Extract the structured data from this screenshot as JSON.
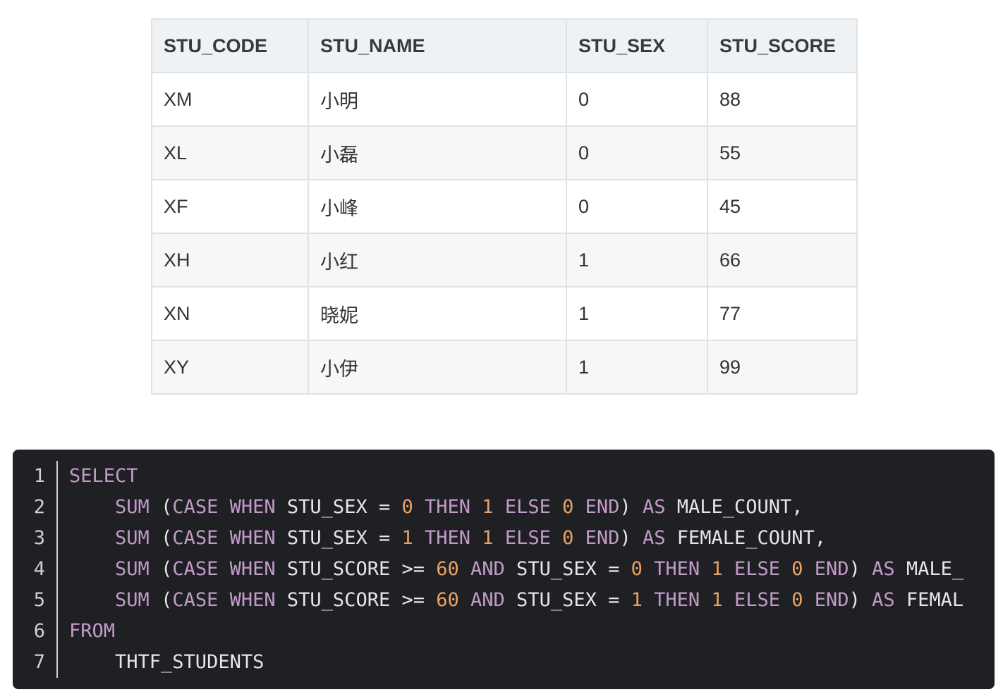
{
  "table": {
    "headers": [
      "STU_CODE",
      "STU_NAME",
      "STU_SEX",
      "STU_SCORE"
    ],
    "rows": [
      [
        "XM",
        "小明",
        "0",
        "88"
      ],
      [
        "XL",
        "小磊",
        "0",
        "55"
      ],
      [
        "XF",
        "小峰",
        "0",
        "45"
      ],
      [
        "XH",
        "小红",
        "1",
        "66"
      ],
      [
        "XN",
        "晓妮",
        "1",
        "77"
      ],
      [
        "XY",
        "小伊",
        "1",
        "99"
      ]
    ]
  },
  "code": {
    "line_numbers": [
      "1",
      "2",
      "3",
      "4",
      "5",
      "6",
      "7"
    ],
    "lines": [
      [
        {
          "t": "kw",
          "v": "SELECT"
        }
      ],
      [
        {
          "t": "id",
          "v": "    "
        },
        {
          "t": "kw",
          "v": "SUM"
        },
        {
          "t": "id",
          "v": " ("
        },
        {
          "t": "kw",
          "v": "CASE"
        },
        {
          "t": "id",
          "v": " "
        },
        {
          "t": "kw",
          "v": "WHEN"
        },
        {
          "t": "id",
          "v": " STU_SEX = "
        },
        {
          "t": "num",
          "v": "0"
        },
        {
          "t": "id",
          "v": " "
        },
        {
          "t": "kw",
          "v": "THEN"
        },
        {
          "t": "id",
          "v": " "
        },
        {
          "t": "num",
          "v": "1"
        },
        {
          "t": "id",
          "v": " "
        },
        {
          "t": "kw",
          "v": "ELSE"
        },
        {
          "t": "id",
          "v": " "
        },
        {
          "t": "num",
          "v": "0"
        },
        {
          "t": "id",
          "v": " "
        },
        {
          "t": "kw",
          "v": "END"
        },
        {
          "t": "id",
          "v": ") "
        },
        {
          "t": "kw",
          "v": "AS"
        },
        {
          "t": "id",
          "v": " MALE_COUNT,"
        }
      ],
      [
        {
          "t": "id",
          "v": "    "
        },
        {
          "t": "kw",
          "v": "SUM"
        },
        {
          "t": "id",
          "v": " ("
        },
        {
          "t": "kw",
          "v": "CASE"
        },
        {
          "t": "id",
          "v": " "
        },
        {
          "t": "kw",
          "v": "WHEN"
        },
        {
          "t": "id",
          "v": " STU_SEX = "
        },
        {
          "t": "num",
          "v": "1"
        },
        {
          "t": "id",
          "v": " "
        },
        {
          "t": "kw",
          "v": "THEN"
        },
        {
          "t": "id",
          "v": " "
        },
        {
          "t": "num",
          "v": "1"
        },
        {
          "t": "id",
          "v": " "
        },
        {
          "t": "kw",
          "v": "ELSE"
        },
        {
          "t": "id",
          "v": " "
        },
        {
          "t": "num",
          "v": "0"
        },
        {
          "t": "id",
          "v": " "
        },
        {
          "t": "kw",
          "v": "END"
        },
        {
          "t": "id",
          "v": ") "
        },
        {
          "t": "kw",
          "v": "AS"
        },
        {
          "t": "id",
          "v": " FEMALE_COUNT,"
        }
      ],
      [
        {
          "t": "id",
          "v": "    "
        },
        {
          "t": "kw",
          "v": "SUM"
        },
        {
          "t": "id",
          "v": " ("
        },
        {
          "t": "kw",
          "v": "CASE"
        },
        {
          "t": "id",
          "v": " "
        },
        {
          "t": "kw",
          "v": "WHEN"
        },
        {
          "t": "id",
          "v": " STU_SCORE >= "
        },
        {
          "t": "num",
          "v": "60"
        },
        {
          "t": "id",
          "v": " "
        },
        {
          "t": "kw",
          "v": "AND"
        },
        {
          "t": "id",
          "v": " STU_SEX = "
        },
        {
          "t": "num",
          "v": "0"
        },
        {
          "t": "id",
          "v": " "
        },
        {
          "t": "kw",
          "v": "THEN"
        },
        {
          "t": "id",
          "v": " "
        },
        {
          "t": "num",
          "v": "1"
        },
        {
          "t": "id",
          "v": " "
        },
        {
          "t": "kw",
          "v": "ELSE"
        },
        {
          "t": "id",
          "v": " "
        },
        {
          "t": "num",
          "v": "0"
        },
        {
          "t": "id",
          "v": " "
        },
        {
          "t": "kw",
          "v": "END"
        },
        {
          "t": "id",
          "v": ") "
        },
        {
          "t": "kw",
          "v": "AS"
        },
        {
          "t": "id",
          "v": " MALE_"
        }
      ],
      [
        {
          "t": "id",
          "v": "    "
        },
        {
          "t": "kw",
          "v": "SUM"
        },
        {
          "t": "id",
          "v": " ("
        },
        {
          "t": "kw",
          "v": "CASE"
        },
        {
          "t": "id",
          "v": " "
        },
        {
          "t": "kw",
          "v": "WHEN"
        },
        {
          "t": "id",
          "v": " STU_SCORE >= "
        },
        {
          "t": "num",
          "v": "60"
        },
        {
          "t": "id",
          "v": " "
        },
        {
          "t": "kw",
          "v": "AND"
        },
        {
          "t": "id",
          "v": " STU_SEX = "
        },
        {
          "t": "num",
          "v": "1"
        },
        {
          "t": "id",
          "v": " "
        },
        {
          "t": "kw",
          "v": "THEN"
        },
        {
          "t": "id",
          "v": " "
        },
        {
          "t": "num",
          "v": "1"
        },
        {
          "t": "id",
          "v": " "
        },
        {
          "t": "kw",
          "v": "ELSE"
        },
        {
          "t": "id",
          "v": " "
        },
        {
          "t": "num",
          "v": "0"
        },
        {
          "t": "id",
          "v": " "
        },
        {
          "t": "kw",
          "v": "END"
        },
        {
          "t": "id",
          "v": ") "
        },
        {
          "t": "kw",
          "v": "AS"
        },
        {
          "t": "id",
          "v": " FEMAL"
        }
      ],
      [
        {
          "t": "kw",
          "v": "FROM"
        }
      ],
      [
        {
          "t": "id",
          "v": "    THTF_STUDENTS"
        }
      ]
    ]
  },
  "colors": {
    "code_background": "#1f2023",
    "keyword": "#c39ac9",
    "number": "#e9a267",
    "identifier": "#e6e6e6",
    "table_header_background": "#eff2f5",
    "table_border": "#dfe2e5"
  }
}
